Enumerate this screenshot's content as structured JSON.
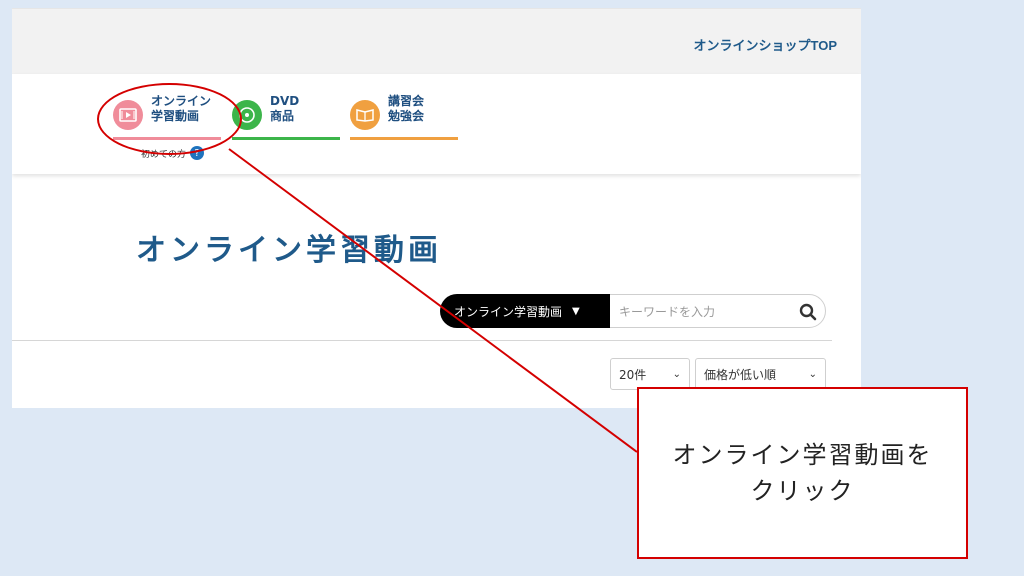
{
  "header": {
    "shop_top_link": "オンラインショップTOP"
  },
  "nav": {
    "items": [
      {
        "label_line1": "オンライン",
        "label_line2": "学習動画",
        "icon": "video-icon",
        "color": "#f08c9a"
      },
      {
        "label_line1": "DVD",
        "label_line2": "商品",
        "icon": "dvd-icon",
        "color": "#3cb54a"
      },
      {
        "label_line1": "講習会",
        "label_line2": "勉強会",
        "icon": "book-icon",
        "color": "#f0a040"
      }
    ],
    "first_time_label": "初めての方",
    "first_time_badge": "?"
  },
  "main": {
    "page_title": "オンライン学習動画",
    "search": {
      "category_label": "オンライン学習動画",
      "placeholder": "キーワードを入力",
      "search_icon": "magnifier-icon"
    },
    "per_page_select": "20件",
    "sort_select": "価格が低い順"
  },
  "annotation": {
    "callout_line1": "オンライン学習動画を",
    "callout_line2": "クリック",
    "highlight_color": "#d40000"
  }
}
